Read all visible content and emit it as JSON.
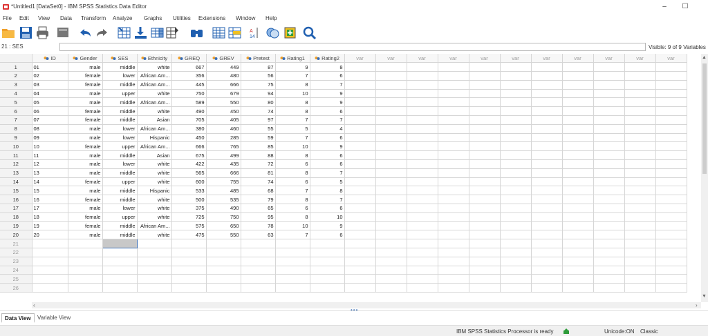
{
  "window": {
    "title": "*Untitled1 [DataSet0] - IBM SPSS Statistics Data Editor",
    "minimize": "–",
    "maximize": "☐"
  },
  "menu": [
    "File",
    "Edit",
    "View",
    "Data",
    "Transform",
    "Analyze",
    "Graphs",
    "Utilities",
    "Extensions",
    "Window",
    "Help"
  ],
  "toolbar": {
    "icons": [
      "open-folder-icon",
      "save-icon",
      "print-icon",
      "recall-dialog-icon",
      "undo-icon",
      "redo-icon",
      "go-to-case-icon",
      "go-to-variable-icon",
      "variables-icon",
      "insert-cases-icon",
      "find-icon",
      "split-file-icon",
      "select-cases-icon",
      "value-labels-icon",
      "use-sets-icon",
      "spelling-icon",
      "search-icon"
    ]
  },
  "cellbar": {
    "reference": "21 : SES",
    "visible": "Visible: 9 of 9 Variables"
  },
  "grid": {
    "columns": [
      {
        "name": "ID",
        "type": "nominal"
      },
      {
        "name": "Gender",
        "type": "nominal"
      },
      {
        "name": "SES",
        "type": "nominal"
      },
      {
        "name": "Ethnicity",
        "type": "nominal"
      },
      {
        "name": "GREQ",
        "type": "nominal"
      },
      {
        "name": "GREV",
        "type": "nominal"
      },
      {
        "name": "Pretest",
        "type": "nominal"
      },
      {
        "name": "Rating1",
        "type": "nominal"
      },
      {
        "name": "Rating2",
        "type": "nominal"
      }
    ],
    "empty_header": "var",
    "empty_columns": 11,
    "rows": [
      [
        "01",
        "male",
        "middle",
        "white",
        "667",
        "449",
        "87",
        "9",
        "8"
      ],
      [
        "02",
        "female",
        "lower",
        "African Am...",
        "356",
        "480",
        "56",
        "7",
        "6"
      ],
      [
        "03",
        "female",
        "middle",
        "African Am...",
        "445",
        "666",
        "75",
        "8",
        "7"
      ],
      [
        "04",
        "male",
        "upper",
        "white",
        "750",
        "679",
        "94",
        "10",
        "9"
      ],
      [
        "05",
        "male",
        "middle",
        "African Am...",
        "589",
        "550",
        "80",
        "8",
        "9"
      ],
      [
        "06",
        "female",
        "middle",
        "white",
        "490",
        "450",
        "74",
        "8",
        "6"
      ],
      [
        "07",
        "female",
        "middle",
        "Asian",
        "705",
        "405",
        "97",
        "7",
        "7"
      ],
      [
        "08",
        "male",
        "lower",
        "African Am...",
        "380",
        "460",
        "55",
        "5",
        "4"
      ],
      [
        "09",
        "male",
        "lower",
        "Hispanic",
        "450",
        "285",
        "59",
        "7",
        "6"
      ],
      [
        "10",
        "female",
        "upper",
        "African Am...",
        "666",
        "765",
        "85",
        "10",
        "9"
      ],
      [
        "11",
        "male",
        "middle",
        "Asian",
        "675",
        "499",
        "88",
        "8",
        "6"
      ],
      [
        "12",
        "male",
        "lower",
        "white",
        "422",
        "435",
        "72",
        "6",
        "6"
      ],
      [
        "13",
        "male",
        "middle",
        "white",
        "565",
        "666",
        "81",
        "8",
        "7"
      ],
      [
        "14",
        "female",
        "upper",
        "white",
        "600",
        "755",
        "74",
        "6",
        "5"
      ],
      [
        "15",
        "male",
        "middle",
        "Hispanic",
        "533",
        "485",
        "68",
        "7",
        "8"
      ],
      [
        "16",
        "female",
        "middle",
        "white",
        "500",
        "535",
        "79",
        "8",
        "7"
      ],
      [
        "17",
        "male",
        "lower",
        "white",
        "375",
        "490",
        "65",
        "6",
        "6"
      ],
      [
        "18",
        "female",
        "upper",
        "white",
        "725",
        "750",
        "95",
        "8",
        "10"
      ],
      [
        "19",
        "female",
        "middle",
        "African Am...",
        "575",
        "650",
        "78",
        "10",
        "9"
      ],
      [
        "20",
        "male",
        "middle",
        "white",
        "475",
        "550",
        "63",
        "7",
        "6"
      ]
    ],
    "empty_row_numbers": [
      "21",
      "22",
      "23",
      "24",
      "25",
      "26"
    ]
  },
  "tabs": {
    "data_view": "Data View",
    "variable_view": "Variable View"
  },
  "status": {
    "processor": "IBM SPSS Statistics Processor is ready",
    "unicode": "Unicode:ON",
    "mode": "Classic"
  },
  "colors": {
    "accent_blue": "#3b6fb6",
    "folder_orange": "#f0a02a",
    "selected_cell": "#c8c8c8"
  }
}
